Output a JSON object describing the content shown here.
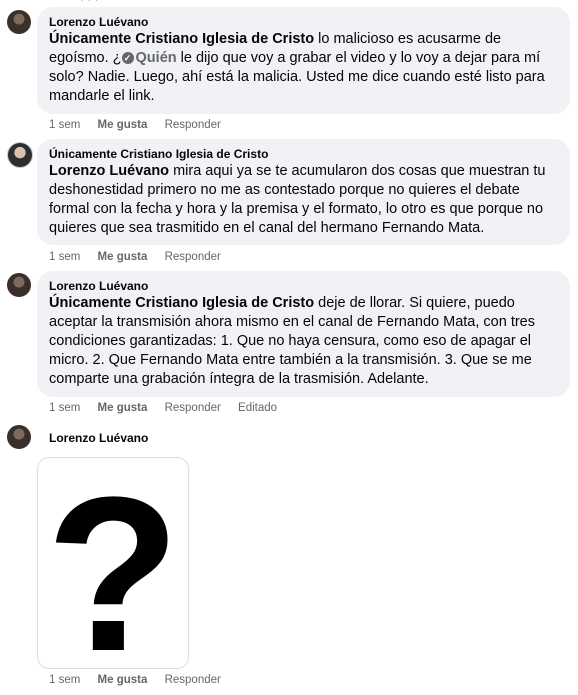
{
  "top_partial": "· · ·",
  "comments": [
    {
      "author": "Lorenzo Luévano",
      "mention": "Únicamente Cristiano Iglesia de Cristo",
      "text1": " lo malicioso es acusarme de egoísmo. ¿",
      "chip_label": "Quién",
      "text2": " le dijo que voy a grabar el video y lo voy a dejar para mí solo? Nadie. Luego, ahí está la malicia. Usted me dice cuando esté listo para mandarle el link.",
      "time": "1 sem",
      "like": "Me gusta",
      "reply": "Responder"
    },
    {
      "author": "Únicamente Cristiano Iglesia de Cristo",
      "mention": "Lorenzo Luévano",
      "text1": " mira aqui ya se te acumularon dos cosas que muestran tu deshonestidad primero no me as contestado porque no quieres el debate formal con la fecha y hora y la premisa y el formato, lo otro es que porque no quieres que sea trasmitido en el canal del hermano Fernando Mata.",
      "time": "1 sem",
      "like": "Me gusta",
      "reply": "Responder"
    },
    {
      "author": "Lorenzo Luévano",
      "mention": "Únicamente Cristiano Iglesia de Cristo",
      "text1": " deje de llorar. Si quiere, puedo aceptar la transmisión ahora mismo en el canal de Fernando Mata, con tres condiciones garantizadas: 1. Que no haya censura, como eso de apagar el micro. 2. Que Fernando Mata entre también a la transmisión. 3. Que se me comparte una grabación íntegra de la trasmisión. Adelante.",
      "time": "1 sem",
      "like": "Me gusta",
      "reply": "Responder",
      "edited": "Editado"
    },
    {
      "author": "Lorenzo Luévano",
      "image_glyph": "?",
      "time": "1 sem",
      "like": "Me gusta",
      "reply": "Responder"
    }
  ]
}
